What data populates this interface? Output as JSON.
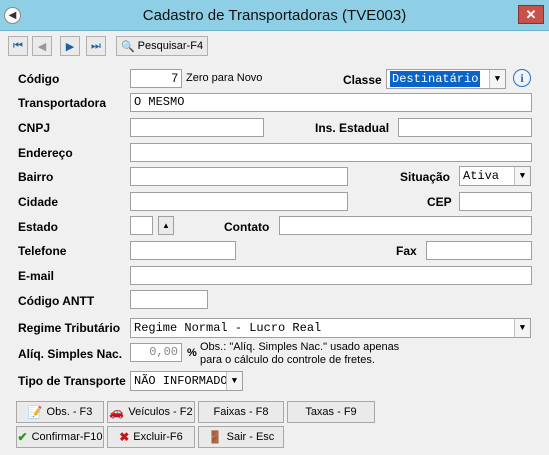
{
  "window": {
    "title": "Cadastro de Transportadoras (TVE003)",
    "close": "✕"
  },
  "toolbar": {
    "first_icon": "⏮",
    "prev_icon": "◀",
    "next_icon": "▶",
    "last_icon": "⏭",
    "search_icon": "🔍",
    "search_label": "Pesquisar-F4"
  },
  "form": {
    "codigo_label": "Código",
    "codigo_value": "7",
    "codigo_hint": "Zero para Novo",
    "classe_label": "Classe",
    "classe_value": "Destinatário",
    "info_icon": "i",
    "transportadora_label": "Transportadora",
    "transportadora_value": "O MESMO",
    "cnpj_label": "CNPJ",
    "cnpj_value": "",
    "ins_estadual_label": "Ins. Estadual",
    "ins_estadual_value": "",
    "endereco_label": "Endereço",
    "endereco_value": "",
    "bairro_label": "Bairro",
    "bairro_value": "",
    "situacao_label": "Situação",
    "situacao_value": "Ativa",
    "cidade_label": "Cidade",
    "cidade_value": "",
    "cep_label": "CEP",
    "cep_value": "",
    "estado_label": "Estado",
    "estado_value": "",
    "contato_label": "Contato",
    "contato_value": "",
    "telefone_label": "Telefone",
    "telefone_value": "",
    "fax_label": "Fax",
    "fax_value": "",
    "email_label": "E-mail",
    "email_value": "",
    "antt_label": "Código ANTT",
    "antt_value": "",
    "regime_label": "Regime Tributário",
    "regime_value": "Regime Normal - Lucro Real",
    "aliq_label": "Alíq. Simples Nac.",
    "aliq_value": "0,00",
    "aliq_unit": "%",
    "aliq_note_1": "Obs.: \"Alíq. Simples Nac.\" usado apenas",
    "aliq_note_2": "para o cálculo do controle de fretes.",
    "tipo_label": "Tipo de Transporte",
    "tipo_value": "NÃO INFORMADO"
  },
  "buttons": {
    "obs": "Obs. - F3",
    "veiculos": "Veículos - F2",
    "faixas": "Faixas - F8",
    "taxas": "Taxas - F9",
    "confirmar": "Confirmar-F10",
    "excluir": "Excluir-F6",
    "sair": "Sair - Esc"
  },
  "dropdown_arrow": "▼",
  "spin_arrow": "▲"
}
